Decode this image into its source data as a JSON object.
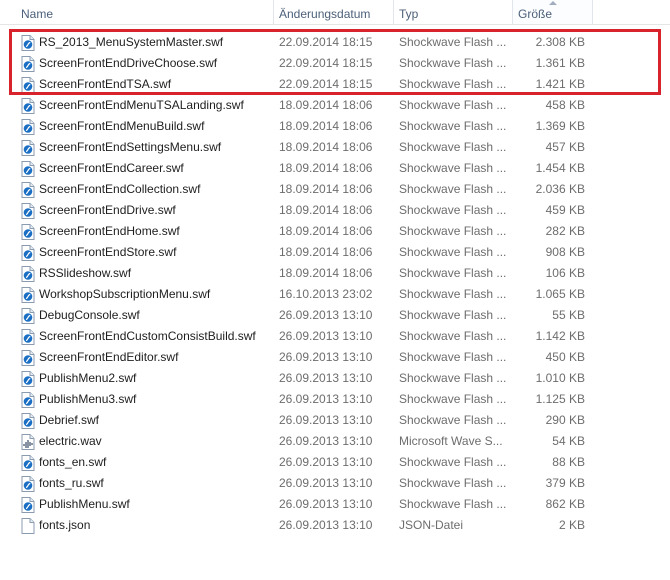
{
  "columns": {
    "name": "Name",
    "date": "Änderungsdatum",
    "type": "Typ",
    "size": "Größe"
  },
  "accent_colors": {
    "highlight": "#d8222c",
    "header_text": "#4c607a"
  },
  "files": [
    {
      "name": "RS_2013_MenuSystemMaster.swf",
      "date": "22.09.2014 18:15",
      "type": "Shockwave Flash ...",
      "size": "2.308 KB",
      "icon": "swf-file-icon"
    },
    {
      "name": "ScreenFrontEndDriveChoose.swf",
      "date": "22.09.2014 18:15",
      "type": "Shockwave Flash ...",
      "size": "1.361 KB",
      "icon": "swf-file-icon"
    },
    {
      "name": "ScreenFrontEndTSA.swf",
      "date": "22.09.2014 18:15",
      "type": "Shockwave Flash ...",
      "size": "1.421 KB",
      "icon": "swf-file-icon"
    },
    {
      "name": "ScreenFrontEndMenuTSALanding.swf",
      "date": "18.09.2014 18:06",
      "type": "Shockwave Flash ...",
      "size": "458 KB",
      "icon": "swf-file-icon"
    },
    {
      "name": "ScreenFrontEndMenuBuild.swf",
      "date": "18.09.2014 18:06",
      "type": "Shockwave Flash ...",
      "size": "1.369 KB",
      "icon": "swf-file-icon"
    },
    {
      "name": "ScreenFrontEndSettingsMenu.swf",
      "date": "18.09.2014 18:06",
      "type": "Shockwave Flash ...",
      "size": "457 KB",
      "icon": "swf-file-icon"
    },
    {
      "name": "ScreenFrontEndCareer.swf",
      "date": "18.09.2014 18:06",
      "type": "Shockwave Flash ...",
      "size": "1.454 KB",
      "icon": "swf-file-icon"
    },
    {
      "name": "ScreenFrontEndCollection.swf",
      "date": "18.09.2014 18:06",
      "type": "Shockwave Flash ...",
      "size": "2.036 KB",
      "icon": "swf-file-icon"
    },
    {
      "name": "ScreenFrontEndDrive.swf",
      "date": "18.09.2014 18:06",
      "type": "Shockwave Flash ...",
      "size": "459 KB",
      "icon": "swf-file-icon"
    },
    {
      "name": "ScreenFrontEndHome.swf",
      "date": "18.09.2014 18:06",
      "type": "Shockwave Flash ...",
      "size": "282 KB",
      "icon": "swf-file-icon"
    },
    {
      "name": "ScreenFrontEndStore.swf",
      "date": "18.09.2014 18:06",
      "type": "Shockwave Flash ...",
      "size": "908 KB",
      "icon": "swf-file-icon"
    },
    {
      "name": "RSSlideshow.swf",
      "date": "18.09.2014 18:06",
      "type": "Shockwave Flash ...",
      "size": "106 KB",
      "icon": "swf-file-icon"
    },
    {
      "name": "WorkshopSubscriptionMenu.swf",
      "date": "16.10.2013 23:02",
      "type": "Shockwave Flash ...",
      "size": "1.065 KB",
      "icon": "swf-file-icon"
    },
    {
      "name": "DebugConsole.swf",
      "date": "26.09.2013 13:10",
      "type": "Shockwave Flash ...",
      "size": "55 KB",
      "icon": "swf-file-icon"
    },
    {
      "name": "ScreenFrontEndCustomConsistBuild.swf",
      "date": "26.09.2013 13:10",
      "type": "Shockwave Flash ...",
      "size": "1.142 KB",
      "icon": "swf-file-icon"
    },
    {
      "name": "ScreenFrontEndEditor.swf",
      "date": "26.09.2013 13:10",
      "type": "Shockwave Flash ...",
      "size": "450 KB",
      "icon": "swf-file-icon"
    },
    {
      "name": "PublishMenu2.swf",
      "date": "26.09.2013 13:10",
      "type": "Shockwave Flash ...",
      "size": "1.010 KB",
      "icon": "swf-file-icon"
    },
    {
      "name": "PublishMenu3.swf",
      "date": "26.09.2013 13:10",
      "type": "Shockwave Flash ...",
      "size": "1.125 KB",
      "icon": "swf-file-icon"
    },
    {
      "name": "Debrief.swf",
      "date": "26.09.2013 13:10",
      "type": "Shockwave Flash ...",
      "size": "290 KB",
      "icon": "swf-file-icon"
    },
    {
      "name": "electric.wav",
      "date": "26.09.2013 13:10",
      "type": "Microsoft Wave S...",
      "size": "54 KB",
      "icon": "wav-file-icon"
    },
    {
      "name": "fonts_en.swf",
      "date": "26.09.2013 13:10",
      "type": "Shockwave Flash ...",
      "size": "88 KB",
      "icon": "swf-file-icon"
    },
    {
      "name": "fonts_ru.swf",
      "date": "26.09.2013 13:10",
      "type": "Shockwave Flash ...",
      "size": "379 KB",
      "icon": "swf-file-icon"
    },
    {
      "name": "PublishMenu.swf",
      "date": "26.09.2013 13:10",
      "type": "Shockwave Flash ...",
      "size": "862 KB",
      "icon": "swf-file-icon"
    },
    {
      "name": "fonts.json",
      "date": "26.09.2013 13:10",
      "type": "JSON-Datei",
      "size": "2 KB",
      "icon": "json-file-icon"
    }
  ]
}
